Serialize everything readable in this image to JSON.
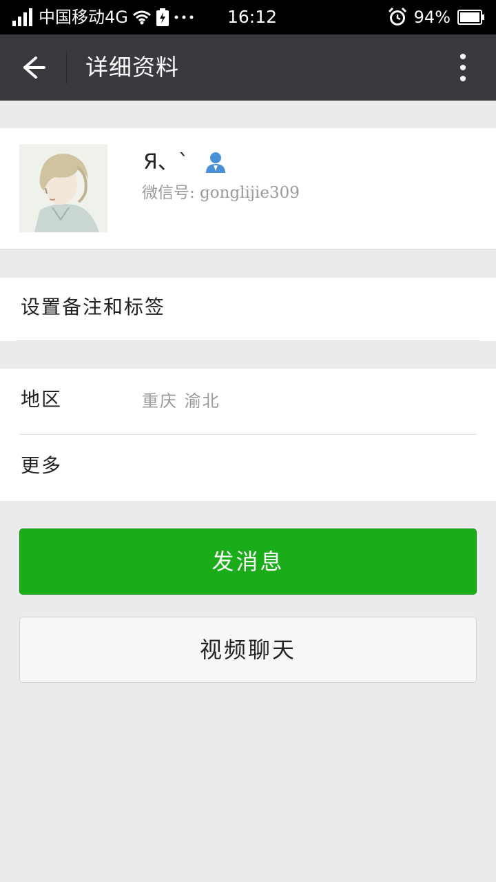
{
  "status_bar": {
    "carrier": "中国移动4G",
    "time": "16:12",
    "battery": "94%",
    "icons": [
      "signal-icon",
      "wifi-icon",
      "battery-saver-icon",
      "more-dots-icon",
      "alarm-icon",
      "battery-icon"
    ]
  },
  "header": {
    "title": "详细资料",
    "back_icon": "back-arrow-icon",
    "menu_icon": "more-vertical-icon"
  },
  "profile": {
    "nickname": "Я、`",
    "wechat_id": "微信号: gonglijie309",
    "gender_icon": "person-icon",
    "accent": "#4a90d9"
  },
  "rows": {
    "remark": "设置备注和标签",
    "region_label": "地区",
    "region_value": "重庆  渝北",
    "more_label": "更多"
  },
  "buttons": {
    "send_message": "发消息",
    "video_chat": "视频聊天"
  },
  "colors": {
    "primary": "#1aad19",
    "header_bg": "#393a3e",
    "page_bg": "#ebebeb"
  }
}
